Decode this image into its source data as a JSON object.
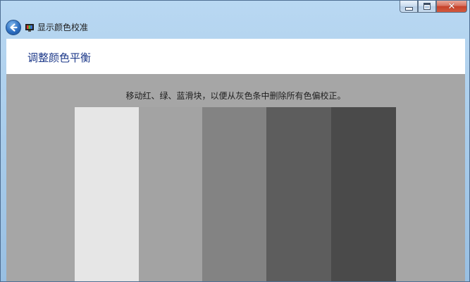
{
  "window": {
    "title": "显示颜色校准",
    "buttons": {
      "minimize": "minimize-icon",
      "maximize": "maximize-icon",
      "close": "close-icon"
    }
  },
  "nav": {
    "back_icon": "back-arrow-icon",
    "app_icon": "monitor-icon"
  },
  "page": {
    "heading": "调整颜色平衡",
    "instruction": "移动红、绿、蓝滑块，以便从灰色条中删除所有色偏校正。"
  },
  "gray_bars": [
    {
      "color": "#e6e6e6"
    },
    {
      "color": "#a3a3a3"
    },
    {
      "color": "#838383"
    },
    {
      "color": "#5d5d5d"
    },
    {
      "color": "#4a4a4a"
    }
  ],
  "colors": {
    "accent": "#1e3a8a",
    "background_gray": "#a6a6a6"
  }
}
